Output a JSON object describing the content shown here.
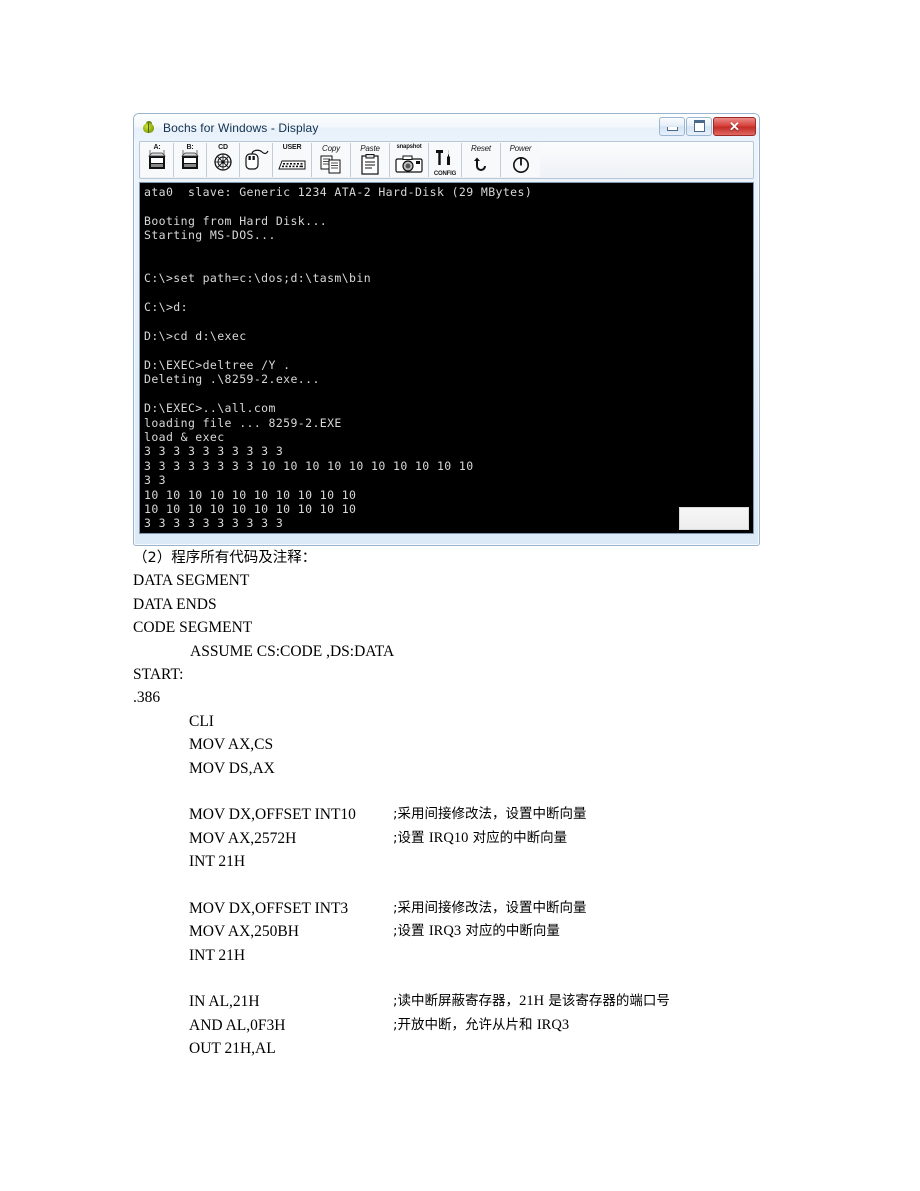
{
  "window": {
    "title": "Bochs for Windows - Display",
    "logo_icon": "bochs-bug-logo",
    "controls": {
      "minimize_label": "",
      "maximize_label": "",
      "close_label": "✕"
    },
    "toolbar": [
      {
        "name": "floppy-a-button",
        "label": "A:",
        "icon": "floppy-drive-icon"
      },
      {
        "name": "floppy-b-button",
        "label": "B:",
        "icon": "floppy-drive-icon"
      },
      {
        "name": "cdrom-button",
        "label": "CD",
        "icon": "cdrom-disc-icon"
      },
      {
        "name": "mouse-button",
        "label": "",
        "icon": "mouse-icon"
      },
      {
        "name": "user-button",
        "label": "USER",
        "icon": "keyboard-icon"
      },
      {
        "name": "copy-button",
        "label": "Copy",
        "icon": "copy-icon"
      },
      {
        "name": "paste-button",
        "label": "Paste",
        "icon": "clipboard-icon"
      },
      {
        "name": "snapshot-button",
        "label": "snapshot",
        "icon": "camera-icon"
      },
      {
        "name": "config-button",
        "label": "CONFIG",
        "icon": "tools-icon"
      },
      {
        "name": "reset-button",
        "label": "Reset",
        "icon": "reset-arrow-icon"
      },
      {
        "name": "power-button",
        "label": "Power",
        "icon": "power-icon"
      }
    ],
    "terminal": {
      "lines": [
        "ata0  slave: Generic 1234 ATA-2 Hard-Disk (29 MBytes)",
        "",
        "Booting from Hard Disk...",
        "Starting MS-DOS...",
        "",
        "",
        "C:\\>set path=c:\\dos;d:\\tasm\\bin",
        "",
        "C:\\>d:",
        "",
        "D:\\>cd d:\\exec",
        "",
        "D:\\EXEC>deltree /Y .",
        "Deleting .\\8259-2.exe...",
        "",
        "D:\\EXEC>..\\all.com",
        "loading file ... 8259-2.EXE",
        "load & exec",
        "3 3 3 3 3 3 3 3 3 3",
        "3 3 3 3 3 3 3 3 10 10 10 10 10 10 10 10 10 10",
        "3 3",
        "10 10 10 10 10 10 10 10 10 10",
        "10 10 10 10 10 10 10 10 10 10",
        "3 3 3 3 3 3 3 3 3 3"
      ]
    }
  },
  "document": {
    "lines": [
      {
        "text": "（2）程序所有代码及注释：",
        "cjk": true,
        "indent": 0
      },
      {
        "text": "DATA SEGMENT",
        "indent": 0
      },
      {
        "text": "DATA ENDS",
        "indent": 0
      },
      {
        "text": "CODE SEGMENT",
        "indent": 0
      },
      {
        "text": "ASSUME CS:CODE ,DS:DATA",
        "indent": 2
      },
      {
        "text": "START:",
        "indent": 0
      },
      {
        "text": ".386",
        "indent": 0
      },
      {
        "text": "CLI",
        "indent": 1
      },
      {
        "text": "MOV AX,CS",
        "indent": 1
      },
      {
        "text": "MOV DS,AX",
        "indent": 1
      },
      {
        "text": "",
        "indent": 1
      },
      {
        "text": "MOV DX,OFFSET INT10",
        "indent": 1,
        "comment": ";采用间接修改法，设置中断向量"
      },
      {
        "text": "MOV AX,2572H",
        "indent": 1,
        "comment": ";设置 IRQ10 对应的中断向量"
      },
      {
        "text": "INT 21H",
        "indent": 1
      },
      {
        "text": "",
        "indent": 1
      },
      {
        "text": "MOV DX,OFFSET INT3",
        "indent": 1,
        "comment": ";采用间接修改法，设置中断向量"
      },
      {
        "text": "MOV AX,250BH",
        "indent": 1,
        "comment": ";设置 IRQ3 对应的中断向量"
      },
      {
        "text": "INT 21H",
        "indent": 1
      },
      {
        "text": "",
        "indent": 1
      },
      {
        "text": "IN AL,21H",
        "indent": 1,
        "comment": ";读中断屏蔽寄存器，21H 是该寄存器的端口号"
      },
      {
        "text": "AND AL,0F3H",
        "indent": 1,
        "comment": ";开放中断，允许从片和 IRQ3"
      },
      {
        "text": "OUT 21H,AL",
        "indent": 1
      }
    ]
  },
  "colors": {
    "title_bar": "#eef4fb",
    "close_button": "#d8423c",
    "terminal_bg": "#000000",
    "terminal_fg": "#d8d8d8",
    "window_border": "#9ab4cf"
  }
}
